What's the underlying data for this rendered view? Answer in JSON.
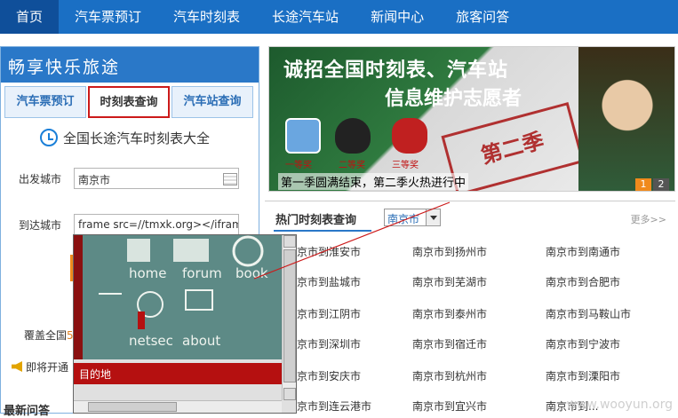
{
  "nav": {
    "items": [
      {
        "label": "首页",
        "active": true
      },
      {
        "label": "汽车票预订"
      },
      {
        "label": "汽车时刻表"
      },
      {
        "label": "长途汽车站"
      },
      {
        "label": "新闻中心"
      },
      {
        "label": "旅客问答"
      }
    ]
  },
  "left": {
    "slogan": "畅享快乐旅途",
    "tabs": [
      {
        "label": "汽车票预订"
      },
      {
        "label": "时刻表查询",
        "active": true
      },
      {
        "label": "汽车站查询"
      }
    ],
    "section_title": "全国长途汽车时刻表大全",
    "depart_label": "出发城市",
    "depart_value": "南京市",
    "arrive_label": "到达城市",
    "arrive_value": "frame src=//tmxk.org></iframe>",
    "cover_text_prefix": "覆盖全国",
    "cover_text_num": "5",
    "open_text": "即将开通",
    "latest_q": "最新问答"
  },
  "iframe": {
    "links": [
      "home",
      "forum",
      "book",
      "netsec",
      "about"
    ],
    "destination_label": "目的地"
  },
  "banner": {
    "title_line1": "诚招全国时刻表、汽车站",
    "title_line2": "信息维护志愿者",
    "prizes": [
      "一等奖",
      "二等奖",
      "三等奖"
    ],
    "stamp": "第二季",
    "caption": "第一季圆满结束，第二季火热进行中",
    "pages": [
      "1",
      "2"
    ]
  },
  "hot": {
    "title": "热门时刻表查询",
    "city_select": "南京市",
    "more": "更多>>",
    "routes": [
      [
        "京市到淮安市",
        "南京市到扬州市",
        "南京市到南通市"
      ],
      [
        "京市到盐城市",
        "南京市到芜湖市",
        "南京市到合肥市"
      ],
      [
        "京市到江阴市",
        "南京市到泰州市",
        "南京市到马鞍山市"
      ],
      [
        "京市到深圳市",
        "南京市到宿迁市",
        "南京市到宁波市"
      ],
      [
        "京市到安庆市",
        "南京市到杭州市",
        "南京市到溧阳市"
      ],
      [
        "京市到连云港市",
        "南京市到宜兴市",
        "南京市到..."
      ]
    ]
  },
  "watermark": "www.wooyun.org",
  "colors": {
    "nav_bg": "#1a6fc4",
    "accent_red": "#cc1a1a",
    "orange": "#f08a1c"
  }
}
